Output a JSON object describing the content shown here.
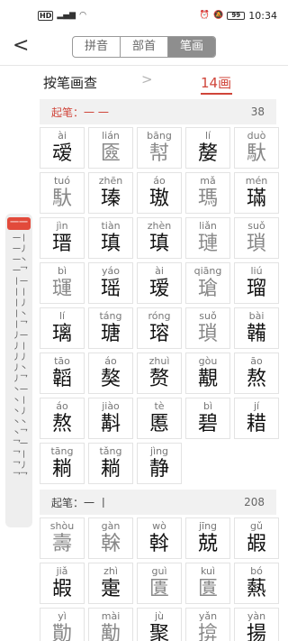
{
  "status": {
    "network": "HD",
    "battery": "99",
    "time": "10:34"
  },
  "header": {
    "back": "<",
    "tabs": [
      "拼音",
      "部首",
      "笔画"
    ],
    "active_tab": 2
  },
  "subbar": {
    "title": "按笔画查",
    "chevron": ">",
    "stroke_count": "14画"
  },
  "index": {
    "active": "一一",
    "strokes": "一丨一丿一丶一乛丨一丨丨丨丿丨丶丨乛丿一丿丨丿丿丿丶丿乛丶一丶丨丶丿丶丶丶乛乛一乛丨乛丿乛乛"
  },
  "sections": [
    {
      "label": "起笔：一 一",
      "count": "38",
      "red": true,
      "chars": [
        {
          "py": "ài",
          "ch": "叆",
          "gray": false
        },
        {
          "py": "lián",
          "ch": "匳",
          "gray": true
        },
        {
          "py": "bāng",
          "ch": "幇",
          "gray": true
        },
        {
          "py": "lí",
          "ch": "嫠",
          "gray": false
        },
        {
          "py": "duò",
          "ch": "馱",
          "gray": true
        },
        {
          "py": "tuó",
          "ch": "馱",
          "gray": true
        },
        {
          "py": "zhēn",
          "ch": "瑧",
          "gray": false
        },
        {
          "py": "áo",
          "ch": "璈",
          "gray": false
        },
        {
          "py": "mǎ",
          "ch": "瑪",
          "gray": true
        },
        {
          "py": "mén",
          "ch": "璊",
          "gray": false
        },
        {
          "py": "jìn",
          "ch": "瑨",
          "gray": false
        },
        {
          "py": "tiàn",
          "ch": "瑱",
          "gray": false
        },
        {
          "py": "zhèn",
          "ch": "瑱",
          "gray": false
        },
        {
          "py": "liǎn",
          "ch": "璉",
          "gray": true
        },
        {
          "py": "suǒ",
          "ch": "瑣",
          "gray": true
        },
        {
          "py": "bì",
          "ch": "璭",
          "gray": true
        },
        {
          "py": "yáo",
          "ch": "瑶",
          "gray": false
        },
        {
          "py": "ài",
          "ch": "瑷",
          "gray": false
        },
        {
          "py": "qiāng",
          "ch": "瑲",
          "gray": true
        },
        {
          "py": "liú",
          "ch": "瑠",
          "gray": false
        },
        {
          "py": "lí",
          "ch": "璃",
          "gray": false
        },
        {
          "py": "táng",
          "ch": "瑭",
          "gray": false
        },
        {
          "py": "róng",
          "ch": "瑢",
          "gray": false
        },
        {
          "py": "suǒ",
          "ch": "瑣",
          "gray": true
        },
        {
          "py": "bài",
          "ch": "韛",
          "gray": false
        },
        {
          "py": "tāo",
          "ch": "韜",
          "gray": false
        },
        {
          "py": "áo",
          "ch": "獒",
          "gray": false
        },
        {
          "py": "zhuì",
          "ch": "赘",
          "gray": false
        },
        {
          "py": "gòu",
          "ch": "覯",
          "gray": false
        },
        {
          "py": "āo",
          "ch": "熬",
          "gray": false
        },
        {
          "py": "áo",
          "ch": "熬",
          "gray": false
        },
        {
          "py": "jiào",
          "ch": "斠",
          "gray": false
        },
        {
          "py": "tè",
          "ch": "慝",
          "gray": false
        },
        {
          "py": "bì",
          "ch": "碧",
          "gray": false
        },
        {
          "py": "jí",
          "ch": "耤",
          "gray": false
        },
        {
          "py": "tāng",
          "ch": "耥",
          "gray": false
        },
        {
          "py": "tǎng",
          "ch": "耥",
          "gray": false
        },
        {
          "py": "jìng",
          "ch": "静",
          "gray": false
        }
      ]
    },
    {
      "label": "起笔：一 丨",
      "count": "208",
      "red": false,
      "chars": [
        {
          "py": "shòu",
          "ch": "壽",
          "gray": true
        },
        {
          "py": "gàn",
          "ch": "榦",
          "gray": true
        },
        {
          "py": "wò",
          "ch": "斡",
          "gray": false
        },
        {
          "py": "jīng",
          "ch": "兢",
          "gray": false
        },
        {
          "py": "gǔ",
          "ch": "嘏",
          "gray": false
        },
        {
          "py": "jiǎ",
          "ch": "嘏",
          "gray": false
        },
        {
          "py": "zhì",
          "ch": "疐",
          "gray": false
        },
        {
          "py": "guì",
          "ch": "匱",
          "gray": true
        },
        {
          "py": "kuì",
          "ch": "匱",
          "gray": true
        },
        {
          "py": "bó",
          "ch": "爇",
          "gray": false
        },
        {
          "py": "yì",
          "ch": "勩",
          "gray": true
        },
        {
          "py": "mài",
          "ch": "勱",
          "gray": true
        },
        {
          "py": "jù",
          "ch": "聚",
          "gray": false
        },
        {
          "py": "yǎn",
          "ch": "揜",
          "gray": true
        },
        {
          "py": "yàn",
          "ch": "揚",
          "gray": false
        }
      ]
    }
  ]
}
